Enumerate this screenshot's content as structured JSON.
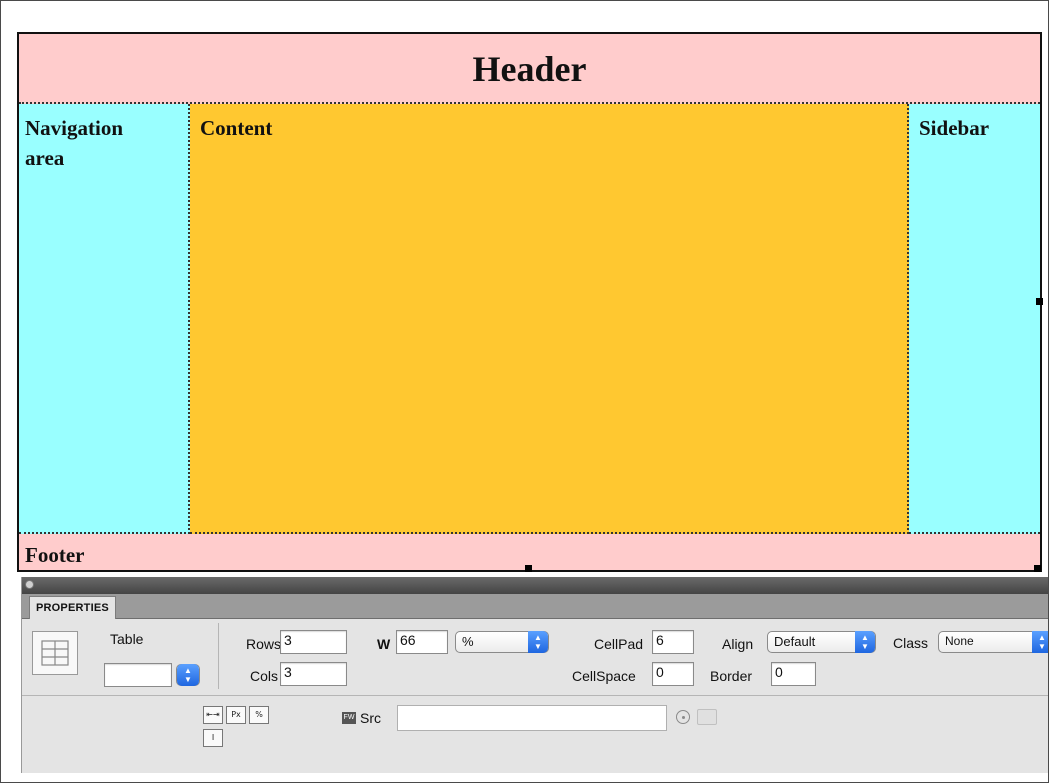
{
  "design": {
    "header": "Header",
    "navigation": "Navigation area",
    "content": "Content",
    "sidebar": "Sidebar",
    "footer": "Footer",
    "colors": {
      "header_bg": "#ffcccc",
      "nav_bg": "#99ffff",
      "content_bg": "#ffc830",
      "sidebar_bg": "#99ffff",
      "footer_bg": "#ffcccc"
    }
  },
  "panel": {
    "tab": "PROPERTIES",
    "table_label": "Table",
    "table_id_value": "",
    "rows_label": "Rows",
    "rows_value": "3",
    "cols_label": "Cols",
    "cols_value": "3",
    "w_label": "W",
    "w_value": "66",
    "w_unit": "%",
    "cellpad_label": "CellPad",
    "cellpad_value": "6",
    "cellspace_label": "CellSpace",
    "cellspace_value": "0",
    "align_label": "Align",
    "align_value": "Default",
    "border_label": "Border",
    "border_value": "0",
    "class_label": "Class",
    "class_value": "None",
    "src_label": "Src",
    "src_value": ""
  }
}
